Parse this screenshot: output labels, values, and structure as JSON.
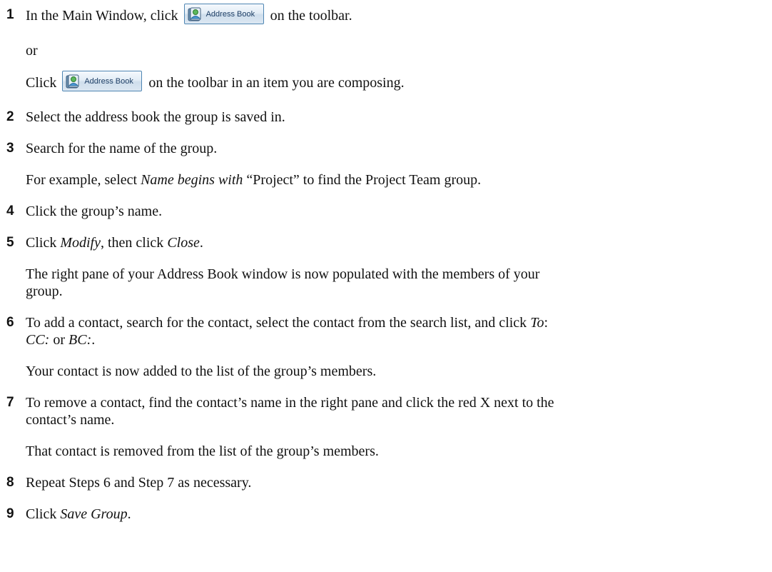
{
  "address_book_button": {
    "icon": "address-book-icon",
    "label": "Address Book"
  },
  "steps": [
    {
      "num": "1",
      "before": "In the Main Window, click",
      "after": "on the toolbar."
    },
    {
      "num": "2",
      "text": "Select the address book the group is saved in."
    },
    {
      "num": "3",
      "text": "Search for the name of the group."
    },
    {
      "num": "4",
      "text": "Click the group’s name."
    },
    {
      "num": "5",
      "pre": "Click ",
      "em1": "Modify",
      "mid": ", then click ",
      "em2": "Close",
      "post": "."
    },
    {
      "num": "6",
      "line1_text": "To add a contact, search for the contact, select the contact from the search list, and click ",
      "line1_em": "To",
      "line1_end": ":",
      "line2_em1": "CC:",
      "line2_mid": " or ",
      "line2_em2": "BC:",
      "line2_end": "."
    },
    {
      "num": "7",
      "line1": "To remove a contact, find the contact’s name in the right pane and click the red X next to the",
      "line2": "contact’s name."
    },
    {
      "num": "8",
      "text": "Repeat Steps 6 and Step 7 as necessary."
    },
    {
      "num": "9",
      "pre": "Click ",
      "em": "Save Group",
      "post": "."
    }
  ],
  "step1_or": "or",
  "step1_alt": {
    "before": "Click",
    "after": "on the toolbar in an item you are composing."
  },
  "step3_example": {
    "pre": "For example, select ",
    "em": "Name begins with",
    "post": " “Project” to find the Project Team group."
  },
  "step5_result": {
    "line1": "The right pane of your Address Book window is now populated with the members of your",
    "line2": "group."
  },
  "step6_result": "Your contact is now added to the list of the group’s members.",
  "step7_result": "That contact is removed from the list of the group’s members."
}
